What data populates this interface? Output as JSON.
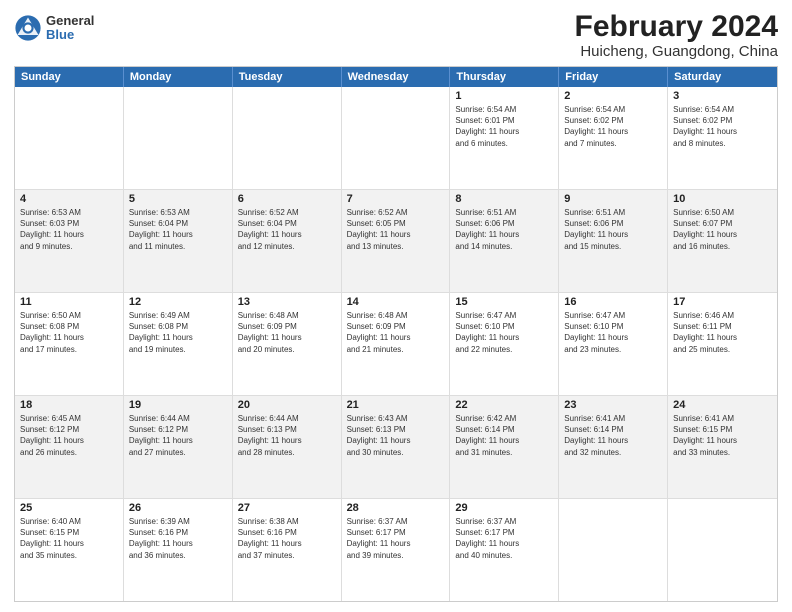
{
  "logo": {
    "general": "General",
    "blue": "Blue"
  },
  "title": "February 2024",
  "subtitle": "Huicheng, Guangdong, China",
  "headers": [
    "Sunday",
    "Monday",
    "Tuesday",
    "Wednesday",
    "Thursday",
    "Friday",
    "Saturday"
  ],
  "rows": [
    [
      {
        "day": "",
        "info": ""
      },
      {
        "day": "",
        "info": ""
      },
      {
        "day": "",
        "info": ""
      },
      {
        "day": "",
        "info": ""
      },
      {
        "day": "1",
        "info": "Sunrise: 6:54 AM\nSunset: 6:01 PM\nDaylight: 11 hours\nand 6 minutes."
      },
      {
        "day": "2",
        "info": "Sunrise: 6:54 AM\nSunset: 6:02 PM\nDaylight: 11 hours\nand 7 minutes."
      },
      {
        "day": "3",
        "info": "Sunrise: 6:54 AM\nSunset: 6:02 PM\nDaylight: 11 hours\nand 8 minutes."
      }
    ],
    [
      {
        "day": "4",
        "info": "Sunrise: 6:53 AM\nSunset: 6:03 PM\nDaylight: 11 hours\nand 9 minutes."
      },
      {
        "day": "5",
        "info": "Sunrise: 6:53 AM\nSunset: 6:04 PM\nDaylight: 11 hours\nand 11 minutes."
      },
      {
        "day": "6",
        "info": "Sunrise: 6:52 AM\nSunset: 6:04 PM\nDaylight: 11 hours\nand 12 minutes."
      },
      {
        "day": "7",
        "info": "Sunrise: 6:52 AM\nSunset: 6:05 PM\nDaylight: 11 hours\nand 13 minutes."
      },
      {
        "day": "8",
        "info": "Sunrise: 6:51 AM\nSunset: 6:06 PM\nDaylight: 11 hours\nand 14 minutes."
      },
      {
        "day": "9",
        "info": "Sunrise: 6:51 AM\nSunset: 6:06 PM\nDaylight: 11 hours\nand 15 minutes."
      },
      {
        "day": "10",
        "info": "Sunrise: 6:50 AM\nSunset: 6:07 PM\nDaylight: 11 hours\nand 16 minutes."
      }
    ],
    [
      {
        "day": "11",
        "info": "Sunrise: 6:50 AM\nSunset: 6:08 PM\nDaylight: 11 hours\nand 17 minutes."
      },
      {
        "day": "12",
        "info": "Sunrise: 6:49 AM\nSunset: 6:08 PM\nDaylight: 11 hours\nand 19 minutes."
      },
      {
        "day": "13",
        "info": "Sunrise: 6:48 AM\nSunset: 6:09 PM\nDaylight: 11 hours\nand 20 minutes."
      },
      {
        "day": "14",
        "info": "Sunrise: 6:48 AM\nSunset: 6:09 PM\nDaylight: 11 hours\nand 21 minutes."
      },
      {
        "day": "15",
        "info": "Sunrise: 6:47 AM\nSunset: 6:10 PM\nDaylight: 11 hours\nand 22 minutes."
      },
      {
        "day": "16",
        "info": "Sunrise: 6:47 AM\nSunset: 6:10 PM\nDaylight: 11 hours\nand 23 minutes."
      },
      {
        "day": "17",
        "info": "Sunrise: 6:46 AM\nSunset: 6:11 PM\nDaylight: 11 hours\nand 25 minutes."
      }
    ],
    [
      {
        "day": "18",
        "info": "Sunrise: 6:45 AM\nSunset: 6:12 PM\nDaylight: 11 hours\nand 26 minutes."
      },
      {
        "day": "19",
        "info": "Sunrise: 6:44 AM\nSunset: 6:12 PM\nDaylight: 11 hours\nand 27 minutes."
      },
      {
        "day": "20",
        "info": "Sunrise: 6:44 AM\nSunset: 6:13 PM\nDaylight: 11 hours\nand 28 minutes."
      },
      {
        "day": "21",
        "info": "Sunrise: 6:43 AM\nSunset: 6:13 PM\nDaylight: 11 hours\nand 30 minutes."
      },
      {
        "day": "22",
        "info": "Sunrise: 6:42 AM\nSunset: 6:14 PM\nDaylight: 11 hours\nand 31 minutes."
      },
      {
        "day": "23",
        "info": "Sunrise: 6:41 AM\nSunset: 6:14 PM\nDaylight: 11 hours\nand 32 minutes."
      },
      {
        "day": "24",
        "info": "Sunrise: 6:41 AM\nSunset: 6:15 PM\nDaylight: 11 hours\nand 33 minutes."
      }
    ],
    [
      {
        "day": "25",
        "info": "Sunrise: 6:40 AM\nSunset: 6:15 PM\nDaylight: 11 hours\nand 35 minutes."
      },
      {
        "day": "26",
        "info": "Sunrise: 6:39 AM\nSunset: 6:16 PM\nDaylight: 11 hours\nand 36 minutes."
      },
      {
        "day": "27",
        "info": "Sunrise: 6:38 AM\nSunset: 6:16 PM\nDaylight: 11 hours\nand 37 minutes."
      },
      {
        "day": "28",
        "info": "Sunrise: 6:37 AM\nSunset: 6:17 PM\nDaylight: 11 hours\nand 39 minutes."
      },
      {
        "day": "29",
        "info": "Sunrise: 6:37 AM\nSunset: 6:17 PM\nDaylight: 11 hours\nand 40 minutes."
      },
      {
        "day": "",
        "info": ""
      },
      {
        "day": "",
        "info": ""
      }
    ]
  ]
}
